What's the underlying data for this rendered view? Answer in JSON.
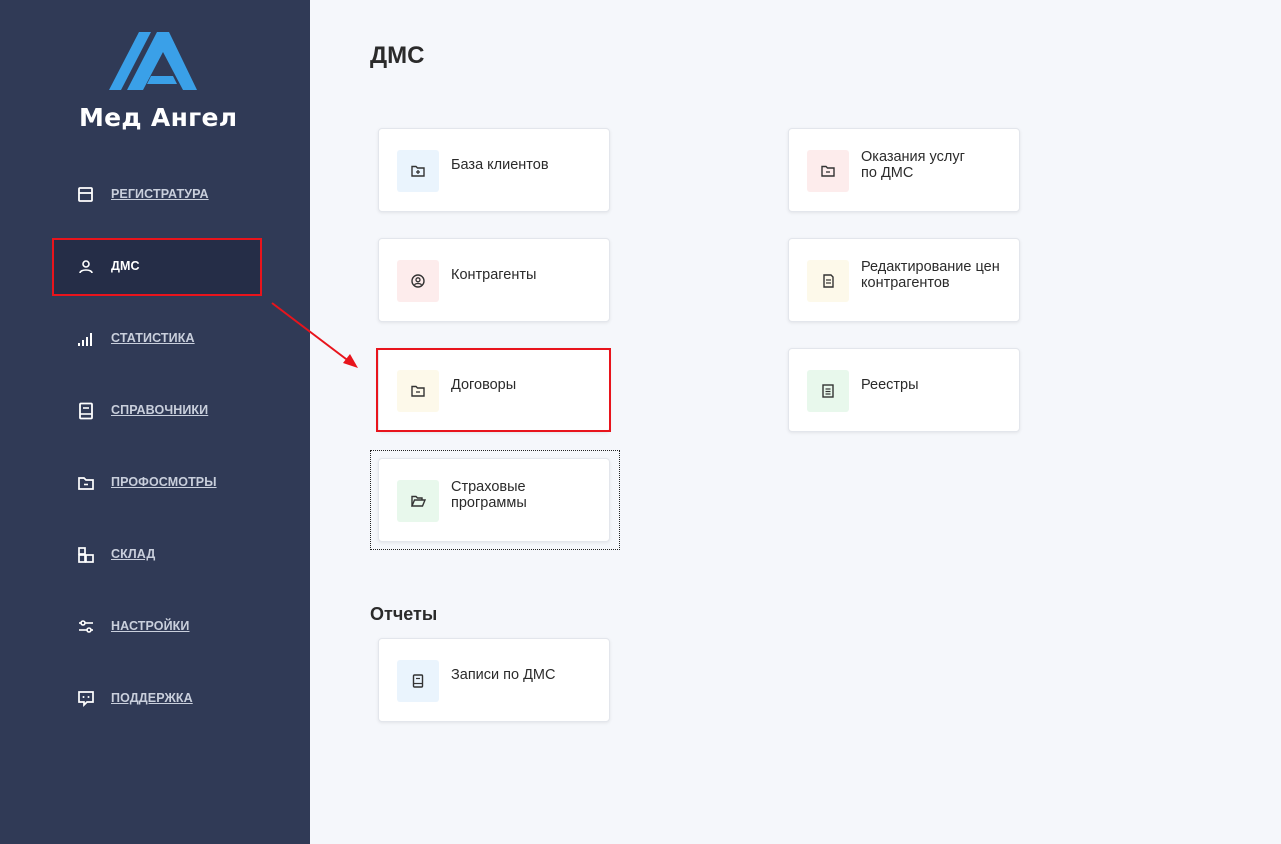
{
  "app": {
    "name": "Мед Ангел"
  },
  "sidebar": {
    "items": [
      {
        "label": "РЕГИСТРАТУРА",
        "icon": "calendar-icon"
      },
      {
        "label": "ДМС",
        "icon": "user-icon",
        "active": true
      },
      {
        "label": "СТАТИСТИКА",
        "icon": "signal-bars-icon"
      },
      {
        "label": "СПРАВОЧНИКИ",
        "icon": "book-icon"
      },
      {
        "label": "ПРОФОСМОТРЫ",
        "icon": "folder-minus-icon"
      },
      {
        "label": "СКЛАД",
        "icon": "boxes-icon"
      },
      {
        "label": "НАСТРОЙКИ",
        "icon": "sliders-icon"
      },
      {
        "label": "ПОДДЕРЖКА",
        "icon": "chat-icon"
      }
    ]
  },
  "main": {
    "title": "ДМС",
    "cards": [
      {
        "label": "База клиентов",
        "icon": "folder-plus-icon",
        "color": "#eaf4fd"
      },
      {
        "label": "Оказания услуг\n по ДМС",
        "icon": "folder-minus-icon",
        "color": "#fdecec"
      },
      {
        "label": "Контрагенты",
        "icon": "user-circle-icon",
        "color": "#fdecec"
      },
      {
        "label": "Редактирование цен контрагентов",
        "icon": "document-icon",
        "color": "#fdf9ea"
      },
      {
        "label": "Договоры",
        "icon": "folder-minus-icon",
        "color": "#fdf9ea"
      },
      {
        "label": "Реестры",
        "icon": "list-document-icon",
        "color": "#e8f8ec"
      },
      {
        "label": "Страховые программы",
        "icon": "folder-open-icon",
        "color": "#e8f8ec"
      }
    ],
    "reports_title": "Отчеты",
    "reports": [
      {
        "label": "Записи по ДМС",
        "icon": "book-icon",
        "color": "#eaf4fd"
      }
    ]
  },
  "colors": {
    "sidebar_bg": "#303a56",
    "sidebar_active_bg": "#252d47",
    "logo_blue": "#3aa0e8",
    "highlight_red": "#e8141c",
    "page_bg": "#f5f7fb"
  }
}
